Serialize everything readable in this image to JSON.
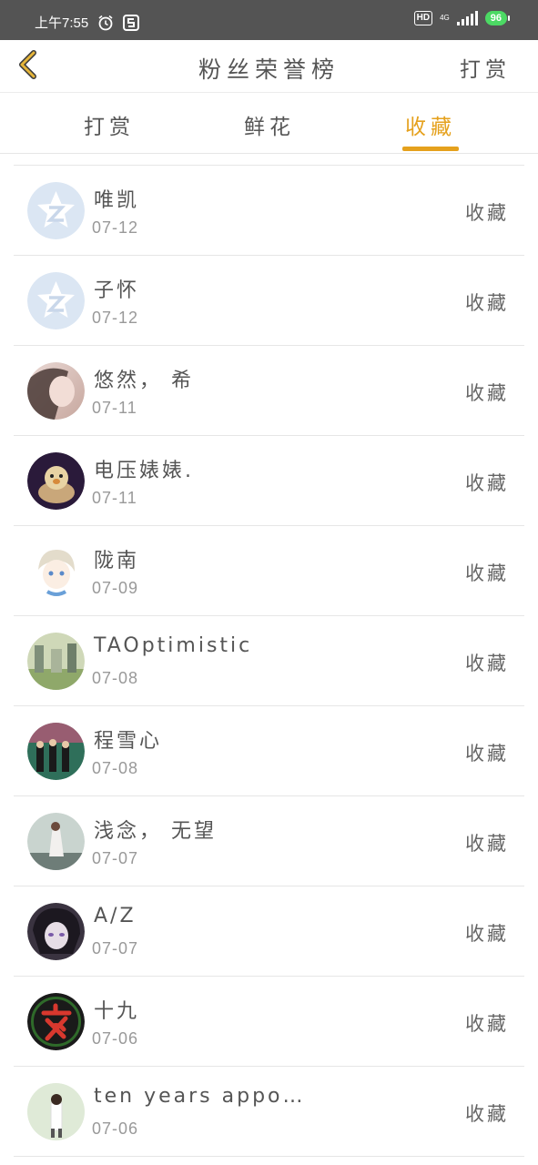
{
  "status": {
    "time": "上午7:55",
    "net": "4G",
    "battery": "96"
  },
  "header": {
    "title": "粉丝荣誉榜",
    "right_link": "打赏"
  },
  "tabs": [
    {
      "label": "打赏",
      "active": false
    },
    {
      "label": "鲜花",
      "active": false
    },
    {
      "label": "收藏",
      "active": true
    }
  ],
  "accent_color": "#e5a11d",
  "fans": [
    {
      "name": "唯凯",
      "date": "07-12",
      "action": "收藏",
      "avatar": "default-star-avatar"
    },
    {
      "name": "子怀",
      "date": "07-12",
      "action": "收藏",
      "avatar": "default-star-avatar"
    },
    {
      "name": "悠然， 希",
      "date": "07-11",
      "action": "收藏",
      "avatar": "photo-avatar"
    },
    {
      "name": "电压婊婊.",
      "date": "07-11",
      "action": "收藏",
      "avatar": "photo-avatar"
    },
    {
      "name": "陇南",
      "date": "07-09",
      "action": "收藏",
      "avatar": "anime-avatar"
    },
    {
      "name": "TAOptimistic",
      "date": "07-08",
      "action": "收藏",
      "avatar": "photo-avatar"
    },
    {
      "name": "程雪心",
      "date": "07-08",
      "action": "收藏",
      "avatar": "photo-avatar"
    },
    {
      "name": "浅念， 无望",
      "date": "07-07",
      "action": "收藏",
      "avatar": "photo-avatar"
    },
    {
      "name": "A/Z",
      "date": "07-07",
      "action": "收藏",
      "avatar": "anime-avatar"
    },
    {
      "name": "十九",
      "date": "07-06",
      "action": "收藏",
      "avatar": "calligraphy-avatar"
    },
    {
      "name": "ten years appo…",
      "date": "07-06",
      "action": "收藏",
      "avatar": "photo-avatar"
    }
  ]
}
